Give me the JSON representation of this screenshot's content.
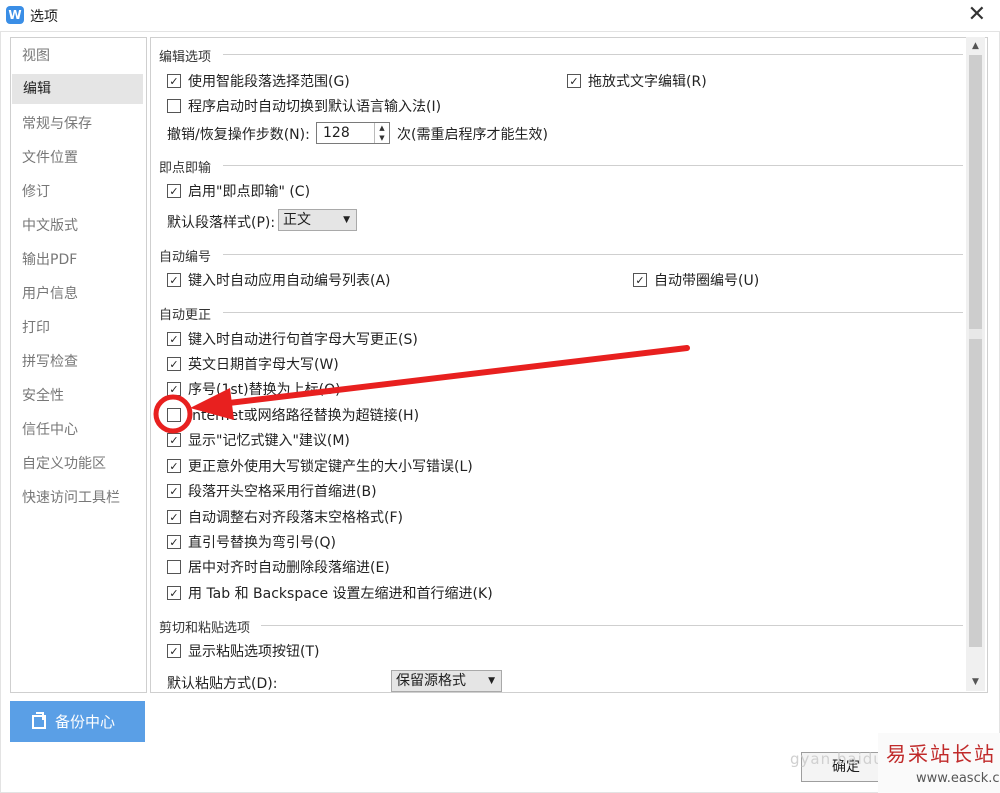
{
  "window": {
    "title": "选项",
    "app_icon": "W"
  },
  "sidebar": {
    "items": [
      {
        "label": "视图"
      },
      {
        "label": "编辑",
        "active": true
      },
      {
        "label": "常规与保存"
      },
      {
        "label": "文件位置"
      },
      {
        "label": "修订"
      },
      {
        "label": "中文版式"
      },
      {
        "label": "输出PDF"
      },
      {
        "label": "用户信息"
      },
      {
        "label": "打印"
      },
      {
        "label": "拼写检查"
      },
      {
        "label": "安全性"
      },
      {
        "label": "信任中心"
      },
      {
        "label": "自定义功能区"
      },
      {
        "label": "快速访问工具栏"
      }
    ]
  },
  "backup": {
    "label": "备份中心"
  },
  "sections": {
    "edit": {
      "title": "编辑选项",
      "smart_select": {
        "label": "使用智能段落选择范围(G)",
        "checked": true
      },
      "drag_edit": {
        "label": "拖放式文字编辑(R)",
        "checked": true
      },
      "auto_ime": {
        "label": "程序启动时自动切换到默认语言输入法(I)",
        "checked": false
      },
      "undo_label": "撤销/恢复操作步数(N):",
      "undo_value": "128",
      "undo_note": "次(需重启程序才能生效)"
    },
    "click": {
      "title": "即点即输",
      "enable": {
        "label": "启用\"即点即输\" (C)",
        "checked": true
      },
      "style_label": "默认段落样式(P):",
      "style_value": "正文"
    },
    "numbering": {
      "title": "自动编号",
      "auto_list": {
        "label": "键入时自动应用自动编号列表(A)",
        "checked": true
      },
      "auto_circle": {
        "label": "自动带圈编号(U)",
        "checked": true
      }
    },
    "correct": {
      "title": "自动更正",
      "items": [
        {
          "label": "键入时自动进行句首字母大写更正(S)",
          "checked": true
        },
        {
          "label": "英文日期首字母大写(W)",
          "checked": true
        },
        {
          "label": "序号(1st)替换为上标(O)",
          "checked": true
        },
        {
          "label": "Internet或网络路径替换为超链接(H)",
          "checked": false
        },
        {
          "label": "显示\"记忆式键入\"建议(M)",
          "checked": true
        },
        {
          "label": "更正意外使用大写锁定键产生的大小写错误(L)",
          "checked": true
        },
        {
          "label": "段落开头空格采用行首缩进(B)",
          "checked": true
        },
        {
          "label": "自动调整右对齐段落末空格格式(F)",
          "checked": true
        },
        {
          "label": "直引号替换为弯引号(Q)",
          "checked": true
        },
        {
          "label": "居中对齐时自动删除段落缩进(E)",
          "checked": false
        },
        {
          "label": "用 Tab 和 Backspace 设置左缩进和首行缩进(K)",
          "checked": true
        }
      ]
    },
    "paste": {
      "title": "剪切和粘贴选项",
      "show_button": {
        "label": "显示粘贴选项按钮(T)",
        "checked": true
      },
      "mode_label": "默认粘贴方式(D):",
      "mode_value": "保留源格式"
    }
  },
  "footer": {
    "ok_label": "确定"
  },
  "watermark": {
    "blur_text": "gyan.baidu",
    "brand": "易采站长站",
    "site": "www.easck.com"
  },
  "colors": {
    "accent": "#5a9fe6",
    "annotation": "#e8201f"
  },
  "icons": {
    "close": "close-icon",
    "check": "check-icon",
    "caret": "chevron-down-icon"
  }
}
